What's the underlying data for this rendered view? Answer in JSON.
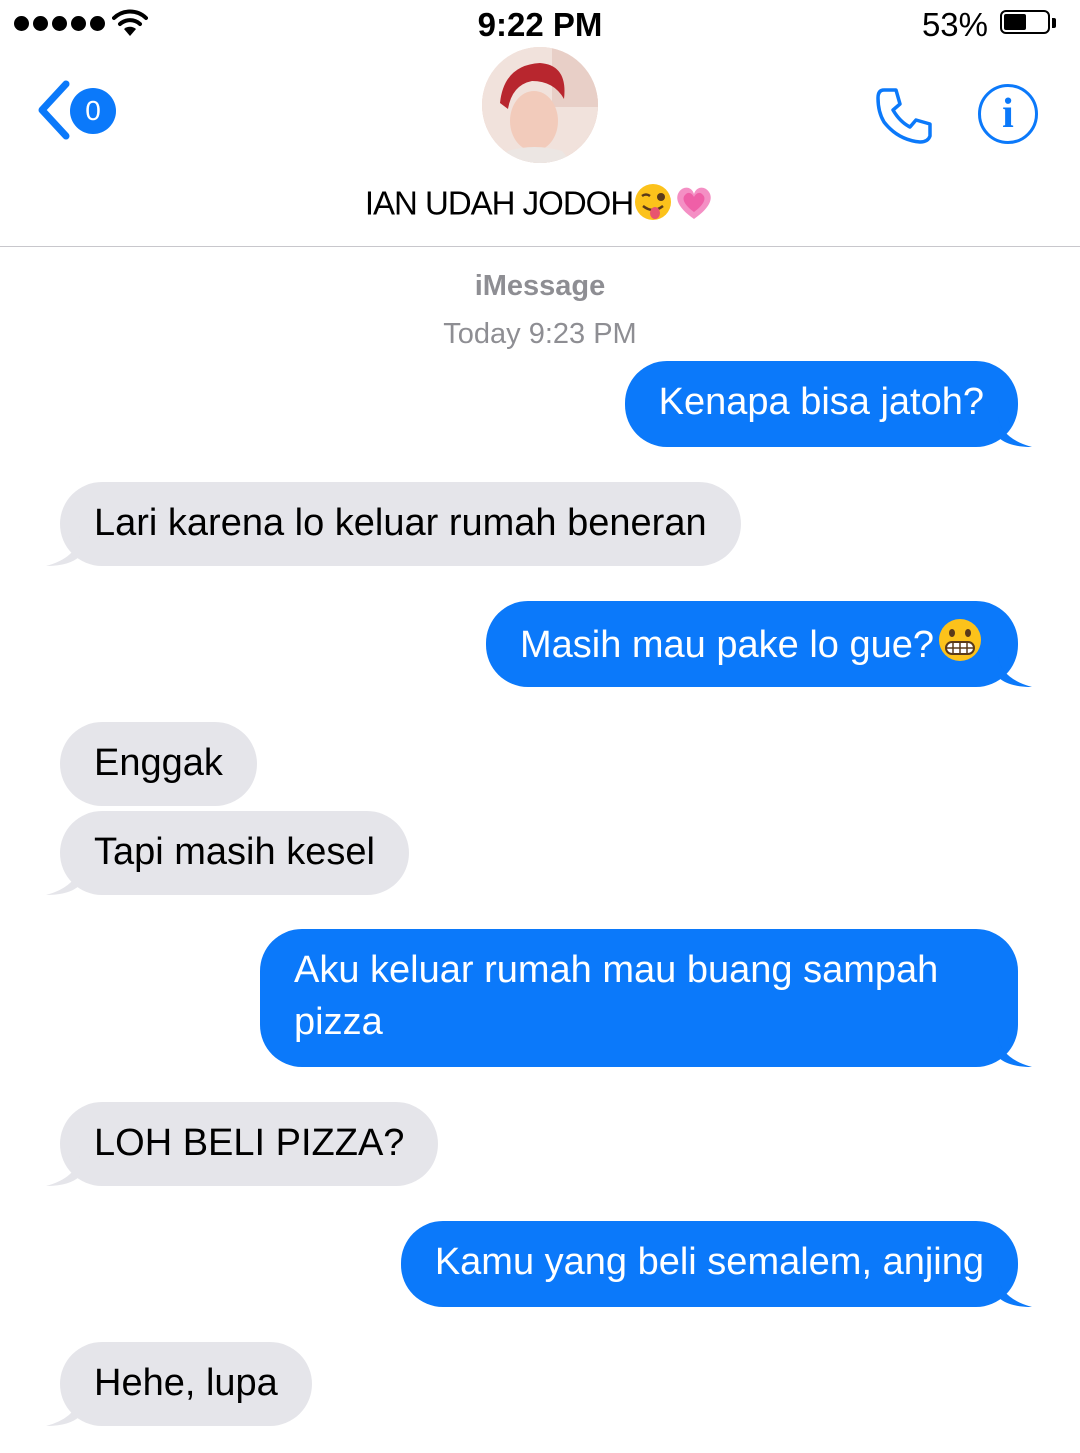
{
  "status_bar": {
    "time": "9:22 PM",
    "battery_percent": "53%",
    "battery_level": 0.53
  },
  "header": {
    "back_badge_count": "0",
    "contact_name": "IAN UDAH JODOH",
    "contact_name_emojis": [
      "winking-face-with-tongue",
      "growing-heart"
    ],
    "accent_color": "#0b79fa"
  },
  "conversation": {
    "service_label": "iMessage",
    "timestamp": "Today 9:23 PM",
    "messages": [
      {
        "from": "me",
        "text": "Kenapa bisa jatoh?"
      },
      {
        "from": "them",
        "text": "Lari karena lo keluar rumah beneran"
      },
      {
        "from": "me",
        "text": "Masih mau pake lo gue?",
        "emoji": "grimacing-face"
      },
      {
        "from": "them",
        "text": "Enggak"
      },
      {
        "from": "them",
        "text": "Tapi masih kesel"
      },
      {
        "from": "me",
        "text": "Aku keluar rumah mau buang sampah pizza"
      },
      {
        "from": "them",
        "text": "LOH BELI PIZZA?"
      },
      {
        "from": "me",
        "text": "Kamu yang beli semalem, anjing"
      },
      {
        "from": "them",
        "text": "Hehe, lupa"
      }
    ]
  },
  "colors": {
    "sent_bubble": "#0b79fa",
    "received_bubble": "#e5e5ea",
    "meta_text": "#8e8e93"
  }
}
